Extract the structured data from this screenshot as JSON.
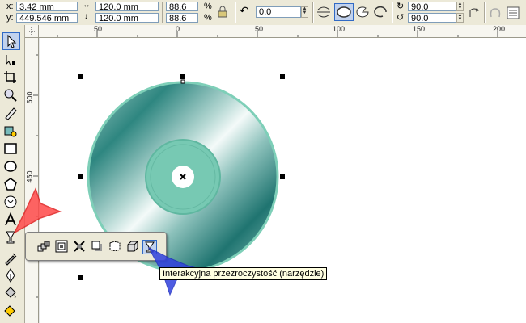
{
  "propbar": {
    "x_label": "x:",
    "x_value": "3.42 mm",
    "y_label": "y:",
    "y_value": "449.546 mm",
    "width_value": "120.0 mm",
    "height_value": "120.0 mm",
    "scale_x": "88.6",
    "scale_y": "88.6",
    "percent_symbol": "%",
    "rotation": "0,0",
    "angle1": "90.0",
    "angle2": "90.0"
  },
  "rulers": {
    "h_ticks": [
      "50",
      "0",
      "50",
      "100",
      "150",
      "200"
    ],
    "v_ticks": [
      "500",
      "450"
    ]
  },
  "tooltip": {
    "text": "Interakcyjna przezroczystość (narzędzie)"
  },
  "colors": {
    "disc_teal": "#5fa8a0",
    "disc_rim": "#7ecfb8",
    "hub": "#77c9b3",
    "selection_accent": "#316ac5",
    "arrow_red": "#ff4040",
    "arrow_blue": "#2f3fd8",
    "tooltip_bg": "#ffffe1"
  }
}
